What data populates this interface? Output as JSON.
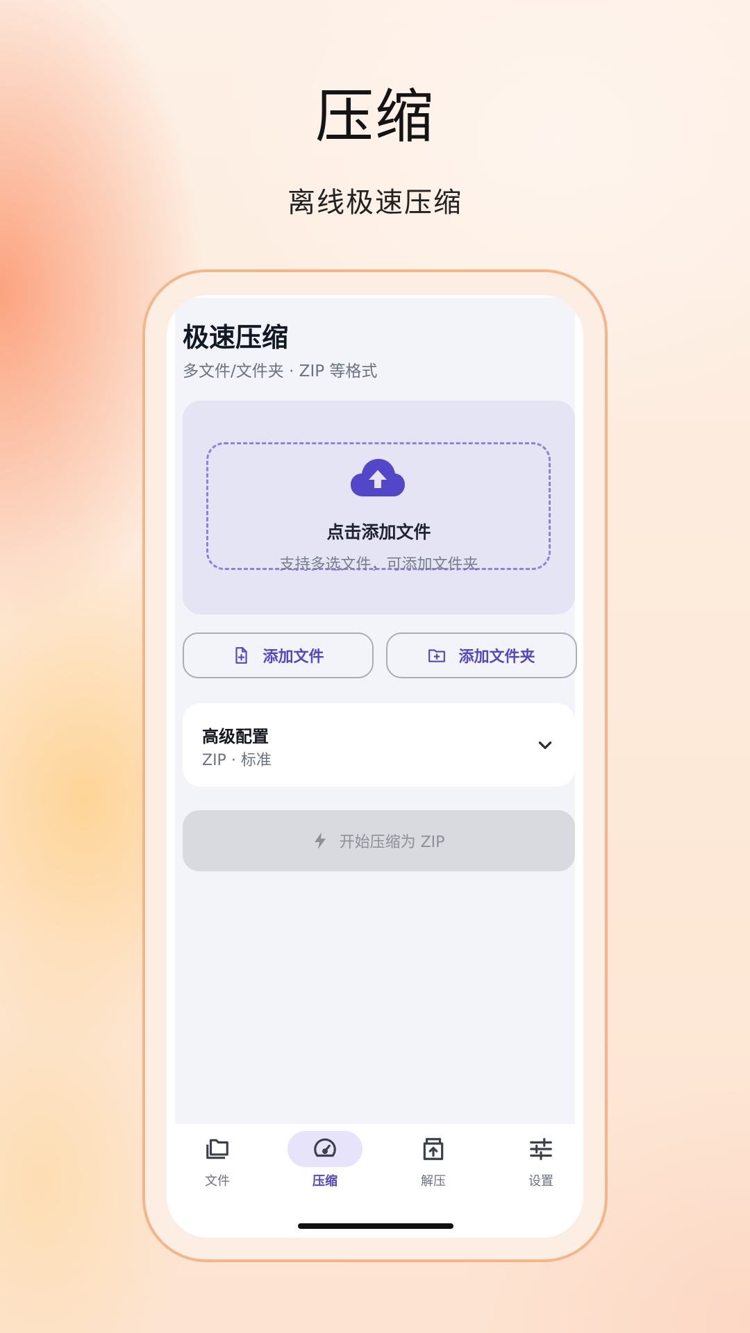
{
  "promo": {
    "headline": "压缩",
    "subline": "离线极速压缩"
  },
  "app": {
    "title": "极速压缩",
    "subtitle": "多文件/文件夹 · ZIP 等格式",
    "upload": {
      "title": "点击添加文件",
      "hint": "支持多选文件，可添加文件夹",
      "icon": "cloud-upload-icon"
    },
    "actions": {
      "add_file_label": "添加文件",
      "add_folder_label": "添加文件夹"
    },
    "config": {
      "title": "高级配置",
      "summary": "ZIP · 标准"
    },
    "start_button_label": "开始压缩为 ZIP",
    "tabs": [
      {
        "label": "文件",
        "icon": "folder-icon",
        "active": false
      },
      {
        "label": "压缩",
        "icon": "speedometer-icon",
        "active": true
      },
      {
        "label": "解压",
        "icon": "archive-upload-icon",
        "active": false
      },
      {
        "label": "设置",
        "icon": "sliders-icon",
        "active": false
      }
    ]
  },
  "colors": {
    "accent": "#5346c8",
    "frame_border": "#f5b589",
    "upload_card_bg": "#e4e4f5",
    "dashed_border": "#8b80e3",
    "disabled_button": "#d9dadf"
  }
}
